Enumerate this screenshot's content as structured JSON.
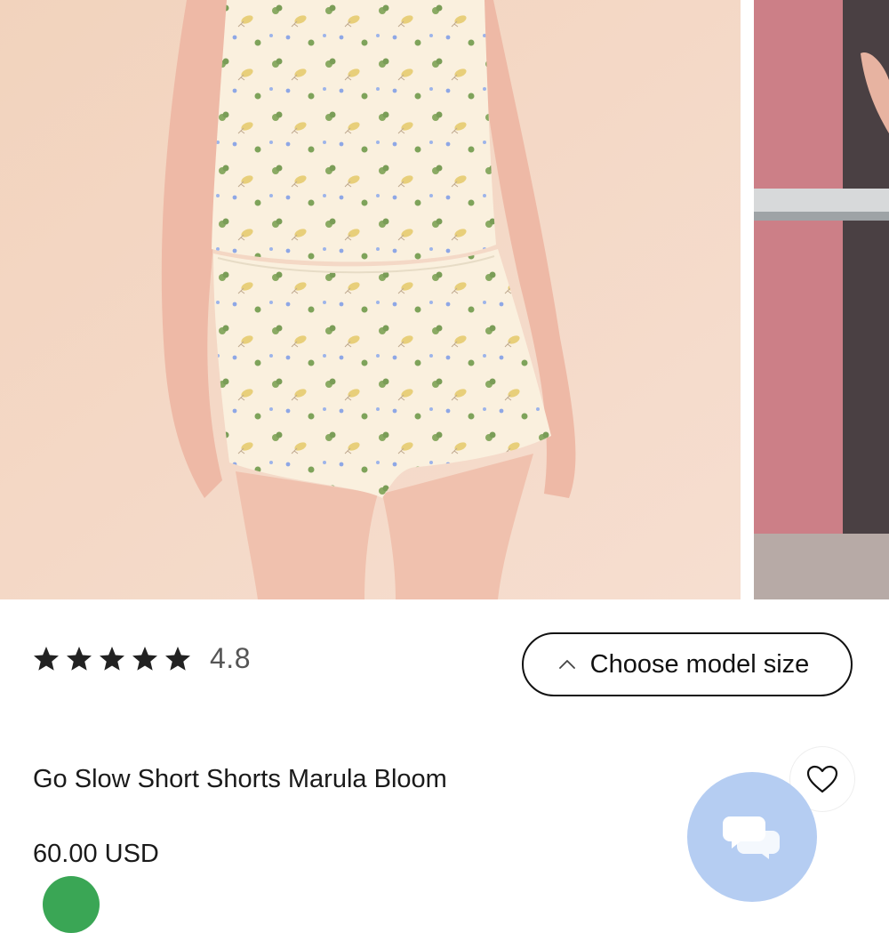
{
  "product": {
    "name": "Go Slow Short Shorts Marula Bloom",
    "price": "60.00 USD",
    "rating": 4.8,
    "rating_display": "4.8",
    "stars_filled": 5
  },
  "gallery": {
    "images": [
      {
        "name": "product-photo-main",
        "alt": ""
      },
      {
        "name": "product-photo-next",
        "alt": ""
      }
    ]
  },
  "actions": {
    "choose_model_size_label": "Choose model size",
    "choose_model_size_icon": "chevron-up-icon",
    "favorite_icon": "heart-icon",
    "chat_icon": "chat-bubbles-icon"
  },
  "colors": {
    "text": "#1a1a1a",
    "rating_text": "#555555",
    "chat_fab": "#b5cdf2",
    "badge": "#3aa655"
  }
}
